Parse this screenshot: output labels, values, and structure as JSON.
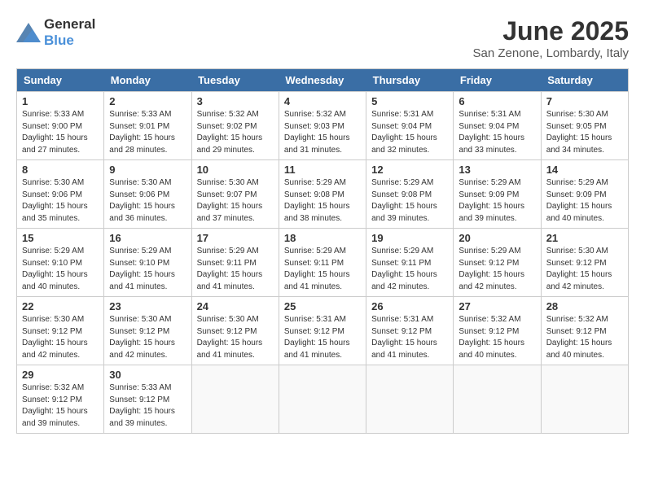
{
  "logo": {
    "general": "General",
    "blue": "Blue"
  },
  "header": {
    "title": "June 2025",
    "subtitle": "San Zenone, Lombardy, Italy"
  },
  "weekdays": [
    "Sunday",
    "Monday",
    "Tuesday",
    "Wednesday",
    "Thursday",
    "Friday",
    "Saturday"
  ],
  "days": [
    {
      "num": "",
      "info": ""
    },
    {
      "num": "",
      "info": ""
    },
    {
      "num": "",
      "info": ""
    },
    {
      "num": "",
      "info": ""
    },
    {
      "num": "",
      "info": ""
    },
    {
      "num": "",
      "info": ""
    },
    {
      "num": "",
      "info": ""
    },
    {
      "num": "1",
      "sunrise": "5:33 AM",
      "sunset": "9:00 PM",
      "daylight": "15 hours and 27 minutes."
    },
    {
      "num": "2",
      "sunrise": "5:33 AM",
      "sunset": "9:01 PM",
      "daylight": "15 hours and 28 minutes."
    },
    {
      "num": "3",
      "sunrise": "5:32 AM",
      "sunset": "9:02 PM",
      "daylight": "15 hours and 29 minutes."
    },
    {
      "num": "4",
      "sunrise": "5:32 AM",
      "sunset": "9:03 PM",
      "daylight": "15 hours and 31 minutes."
    },
    {
      "num": "5",
      "sunrise": "5:31 AM",
      "sunset": "9:04 PM",
      "daylight": "15 hours and 32 minutes."
    },
    {
      "num": "6",
      "sunrise": "5:31 AM",
      "sunset": "9:04 PM",
      "daylight": "15 hours and 33 minutes."
    },
    {
      "num": "7",
      "sunrise": "5:30 AM",
      "sunset": "9:05 PM",
      "daylight": "15 hours and 34 minutes."
    },
    {
      "num": "8",
      "sunrise": "5:30 AM",
      "sunset": "9:06 PM",
      "daylight": "15 hours and 35 minutes."
    },
    {
      "num": "9",
      "sunrise": "5:30 AM",
      "sunset": "9:06 PM",
      "daylight": "15 hours and 36 minutes."
    },
    {
      "num": "10",
      "sunrise": "5:30 AM",
      "sunset": "9:07 PM",
      "daylight": "15 hours and 37 minutes."
    },
    {
      "num": "11",
      "sunrise": "5:29 AM",
      "sunset": "9:08 PM",
      "daylight": "15 hours and 38 minutes."
    },
    {
      "num": "12",
      "sunrise": "5:29 AM",
      "sunset": "9:08 PM",
      "daylight": "15 hours and 39 minutes."
    },
    {
      "num": "13",
      "sunrise": "5:29 AM",
      "sunset": "9:09 PM",
      "daylight": "15 hours and 39 minutes."
    },
    {
      "num": "14",
      "sunrise": "5:29 AM",
      "sunset": "9:09 PM",
      "daylight": "15 hours and 40 minutes."
    },
    {
      "num": "15",
      "sunrise": "5:29 AM",
      "sunset": "9:10 PM",
      "daylight": "15 hours and 40 minutes."
    },
    {
      "num": "16",
      "sunrise": "5:29 AM",
      "sunset": "9:10 PM",
      "daylight": "15 hours and 41 minutes."
    },
    {
      "num": "17",
      "sunrise": "5:29 AM",
      "sunset": "9:11 PM",
      "daylight": "15 hours and 41 minutes."
    },
    {
      "num": "18",
      "sunrise": "5:29 AM",
      "sunset": "9:11 PM",
      "daylight": "15 hours and 41 minutes."
    },
    {
      "num": "19",
      "sunrise": "5:29 AM",
      "sunset": "9:11 PM",
      "daylight": "15 hours and 42 minutes."
    },
    {
      "num": "20",
      "sunrise": "5:29 AM",
      "sunset": "9:12 PM",
      "daylight": "15 hours and 42 minutes."
    },
    {
      "num": "21",
      "sunrise": "5:30 AM",
      "sunset": "9:12 PM",
      "daylight": "15 hours and 42 minutes."
    },
    {
      "num": "22",
      "sunrise": "5:30 AM",
      "sunset": "9:12 PM",
      "daylight": "15 hours and 42 minutes."
    },
    {
      "num": "23",
      "sunrise": "5:30 AM",
      "sunset": "9:12 PM",
      "daylight": "15 hours and 42 minutes."
    },
    {
      "num": "24",
      "sunrise": "5:30 AM",
      "sunset": "9:12 PM",
      "daylight": "15 hours and 41 minutes."
    },
    {
      "num": "25",
      "sunrise": "5:31 AM",
      "sunset": "9:12 PM",
      "daylight": "15 hours and 41 minutes."
    },
    {
      "num": "26",
      "sunrise": "5:31 AM",
      "sunset": "9:12 PM",
      "daylight": "15 hours and 41 minutes."
    },
    {
      "num": "27",
      "sunrise": "5:32 AM",
      "sunset": "9:12 PM",
      "daylight": "15 hours and 40 minutes."
    },
    {
      "num": "28",
      "sunrise": "5:32 AM",
      "sunset": "9:12 PM",
      "daylight": "15 hours and 40 minutes."
    },
    {
      "num": "29",
      "sunrise": "5:32 AM",
      "sunset": "9:12 PM",
      "daylight": "15 hours and 39 minutes."
    },
    {
      "num": "30",
      "sunrise": "5:33 AM",
      "sunset": "9:12 PM",
      "daylight": "15 hours and 39 minutes."
    },
    {
      "num": "",
      "info": ""
    },
    {
      "num": "",
      "info": ""
    },
    {
      "num": "",
      "info": ""
    },
    {
      "num": "",
      "info": ""
    },
    {
      "num": "",
      "info": ""
    }
  ]
}
